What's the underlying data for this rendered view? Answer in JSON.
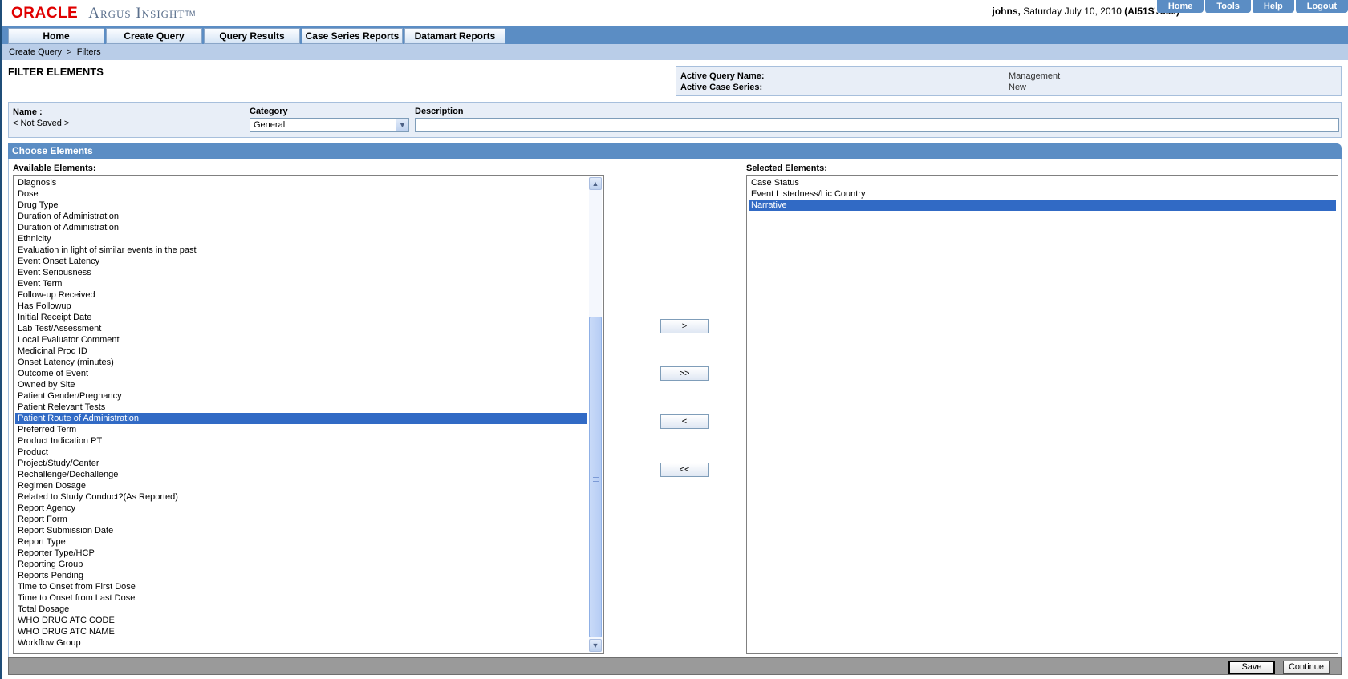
{
  "header": {
    "logo_oracle": "ORACLE",
    "logo_argus": "Argus Insight",
    "logo_tm": "TM",
    "user": "johns,",
    "date": "Saturday July 10, 2010",
    "server": "(AI51ST360)",
    "top_links": [
      "Home",
      "Tools",
      "Help",
      "Logout"
    ]
  },
  "nav": {
    "tabs": [
      "Home",
      "Create Query",
      "Query Results",
      "Case Series Reports",
      "Datamart Reports"
    ]
  },
  "breadcrumb": {
    "items": [
      "Create Query",
      "Filters"
    ],
    "separator": ">"
  },
  "page": {
    "title": "FILTER ELEMENTS"
  },
  "active": {
    "query_label": "Active Query Name:",
    "query_value": "Management",
    "series_label": "Active Case Series:",
    "series_value": "New"
  },
  "form": {
    "name_label": "Name :",
    "name_value": "< Not Saved >",
    "category_label": "Category",
    "category_value": "General",
    "description_label": "Description",
    "description_value": ""
  },
  "choose": {
    "header": "Choose Elements",
    "available_label": "Available Elements:",
    "selected_label": "Selected Elements:",
    "available_items": [
      "Diagnosis",
      "Dose",
      "Drug Type",
      "Duration of Administration",
      "Duration of Administration",
      "Ethnicity",
      "Evaluation in light of similar events in the past",
      "Event Onset Latency",
      "Event Seriousness",
      "Event Term",
      "Follow-up Received",
      "Has Followup",
      "Initial Receipt Date",
      "Lab Test/Assessment",
      "Local Evaluator Comment",
      "Medicinal Prod ID",
      "Onset Latency (minutes)",
      "Outcome of Event",
      "Owned by Site",
      "Patient Gender/Pregnancy",
      "Patient Relevant Tests",
      "Patient Route of Administration",
      "Preferred Term",
      "Product Indication PT",
      "Product",
      "Project/Study/Center",
      "Rechallenge/Dechallenge",
      "Regimen Dosage",
      "Related to Study Conduct?(As Reported)",
      "Report Agency",
      "Report Form",
      "Report Submission Date",
      "Report Type",
      "Reporter Type/HCP",
      "Reporting Group",
      "Reports Pending",
      "Time to Onset from First Dose",
      "Time to Onset from Last Dose",
      "Total Dosage",
      "WHO DRUG ATC CODE",
      "WHO DRUG ATC NAME",
      "Workflow Group"
    ],
    "available_selected": "Patient Route of Administration",
    "selected_items": [
      "Case Status",
      "Event Listedness/Lic Country",
      "Narrative"
    ],
    "selected_selected": "Narrative",
    "buttons": {
      "add": ">",
      "add_all": ">>",
      "remove": "<",
      "remove_all": "<<"
    }
  },
  "footer": {
    "save": "Save",
    "continue": "Continue"
  },
  "colors": {
    "nav_blue": "#5b8dc4",
    "selection": "#316ac5",
    "oracle_red": "#e00000"
  }
}
